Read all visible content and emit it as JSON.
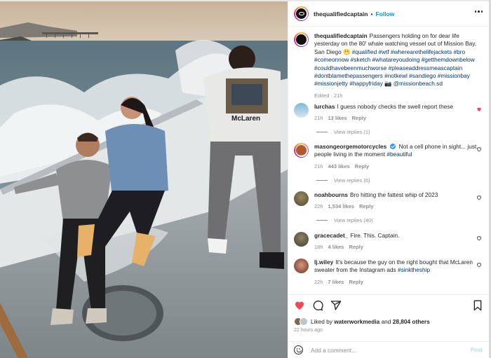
{
  "header": {
    "username": "thequalifiedcaptain",
    "separator": "•",
    "follow_label": "Follow",
    "more_icon": "more-horizontal-icon"
  },
  "caption": {
    "username": "thequalifiedcaptain",
    "text_lines": [
      "Passengers holding on for dear life",
      "yesterday on the 80' whale watching vessel out of Mission Bay,",
      "San Diego 😬"
    ],
    "hashtag_lines": [
      "#qualified #wtf #wherearethelifejackets #bro",
      "#comeonnow #sketch #whatareyoudoing #getthemdownbelow",
      "#couldhavebeenmuchworse #pleaseaddressmeascaptain",
      "#dontblamethepassengers #notkewl #sandiego #missionbay",
      "#missionjetty #happyfriday 📷 @missionbeach.sd"
    ],
    "meta": "Edited · 21h"
  },
  "comments": [
    {
      "username": "lurchas",
      "text": "I guess nobody checks the swell report these",
      "time": "21h",
      "likes": "13 likes",
      "reply": "Reply",
      "view_replies": "View replies (1)",
      "liked": true
    },
    {
      "username": "masongeorgemotorcycles",
      "text_a": "Not a cell phone in sight... just",
      "text_b": "people living in the moment",
      "tag": "#beautiful",
      "time": "21h",
      "likes": "443 likes",
      "reply": "Reply",
      "view_replies": "View replies (6)",
      "liked": false
    },
    {
      "username": "noahbourns",
      "text": "Bro hitting the fattest whip of 2023",
      "time": "22h",
      "likes": "1,534 likes",
      "reply": "Reply",
      "view_replies": "View replies (40)",
      "liked": false
    },
    {
      "username": "gracecadet_",
      "text": "Fire. This. Captain.",
      "time": "18h",
      "likes": "4 likes",
      "reply": "Reply",
      "liked": false
    },
    {
      "username": "lj.wiley",
      "text_a": "It's because the guy on the right bought that McLaren",
      "text_b": "sweater from the Instagram ads",
      "tag": "#sinktheship",
      "time": "22h",
      "likes": "7 likes",
      "reply": "Reply",
      "liked": false
    }
  ],
  "actions": {
    "liked_by_prefix": "Liked by",
    "liked_by_user": "waterworkmedia",
    "liked_by_and": "and",
    "liked_by_count": "28,804 others",
    "time_ago": "22 hours ago"
  },
  "add_comment": {
    "placeholder": "Add a comment...",
    "post_label": "Post"
  },
  "photo": {
    "sweater_text": "McLaren"
  },
  "colors": {
    "accent": "#0095f6",
    "like_red": "#ed4956",
    "hashtag": "#00376b",
    "muted": "#8e8e8e"
  }
}
